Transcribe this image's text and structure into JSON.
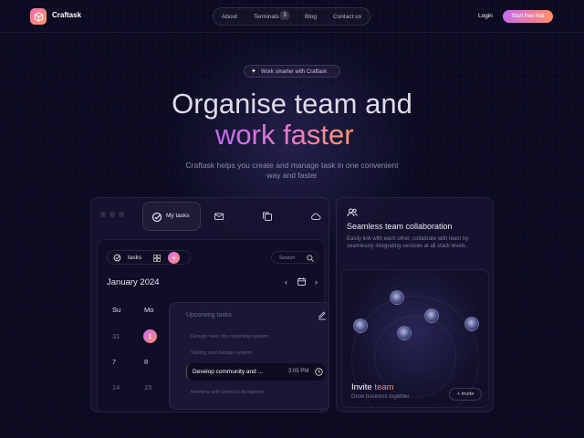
{
  "nav": {
    "brand": "Craftask",
    "links": [
      "About",
      "Terminals",
      "Blog",
      "Contact us"
    ],
    "terminals_badge": "3",
    "login": "Login",
    "cta": "Start free trial"
  },
  "hero": {
    "pill": "Work smarter with Craftask",
    "title_line1": "Organise team and",
    "title_line2": "work faster",
    "subtitle": "Craftask helps you create and manage task in one convenient way and faster"
  },
  "app": {
    "active_tab": "My tasks",
    "tasks_filter": "tasks",
    "add_label": "+",
    "search_placeholder": "Search",
    "month": "January 2024",
    "weekdays": [
      "Su",
      "Mo"
    ],
    "days": [
      [
        "31",
        "1"
      ],
      [
        "7",
        "8"
      ],
      [
        "14",
        "15"
      ]
    ],
    "upcoming": {
      "title": "Upcoming tasks",
      "items": [
        "Design new site reporting system",
        "Styling and design system",
        "Meeting with product designers"
      ],
      "active_task": "Develop community and ...",
      "active_time": "3:05 PM"
    }
  },
  "collab": {
    "title": "Seamless team collaboration",
    "description": "Easily link with each other, collabrate with team by seamlessly integrating services at all stack levels.",
    "invite_title_plain": "Invite",
    "invite_title_accent": "team",
    "invite_sub": "Grow business together",
    "invite_button": "+ Invite"
  },
  "colors": {
    "background": "#0c0b22",
    "accent_start": "#c86bf0",
    "accent_end": "#ff8f6a"
  }
}
